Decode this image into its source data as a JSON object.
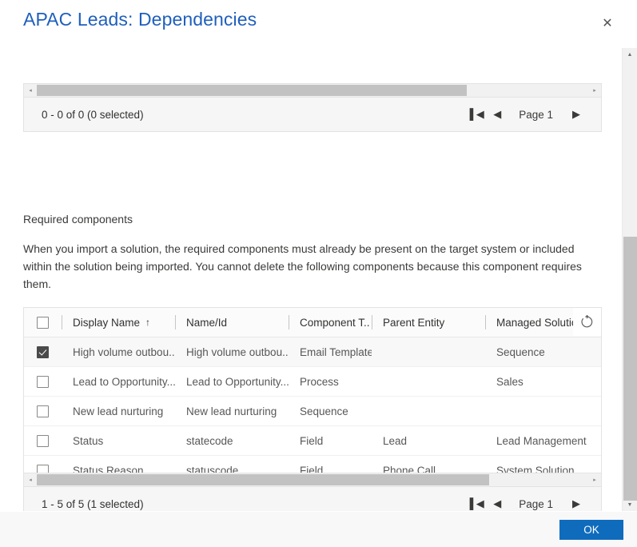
{
  "dialog": {
    "title": "APAC Leads: Dependencies",
    "close_label": "✕",
    "close_icon": "close-icon"
  },
  "top_grid": {
    "hscroll": {
      "left_arrow": "◂",
      "right_arrow": "▸",
      "thumb_percent": 78
    },
    "pager": {
      "count_text": "0 - 0 of 0 (0 selected)",
      "first_icon": "▌◀",
      "prev_icon": "◀",
      "page_label": "Page 1",
      "next_icon": "▶"
    }
  },
  "required": {
    "heading": "Required components",
    "description": "When you import a solution, the required components must already be present on the target system or included within the solution being imported. You cannot delete the following components because this component requires them."
  },
  "grid": {
    "select_all_checked": false,
    "spinner_icon": "refresh-spinner-icon",
    "columns": [
      {
        "key": "checkbox",
        "label": ""
      },
      {
        "key": "display_name",
        "label": "Display Name",
        "sort": "↑"
      },
      {
        "key": "name_id",
        "label": "Name/Id"
      },
      {
        "key": "component_type",
        "label": "Component T.."
      },
      {
        "key": "parent_entity",
        "label": "Parent Entity"
      },
      {
        "key": "managed_solution",
        "label": "Managed Solution"
      }
    ],
    "rows": [
      {
        "selected": true,
        "display_name": "High volume outbou...",
        "name_id": "High volume outbou...",
        "component_type": "Email Template",
        "parent_entity": "",
        "managed_solution": "Sequence"
      },
      {
        "selected": false,
        "display_name": "Lead to Opportunity...",
        "name_id": "Lead to Opportunity...",
        "component_type": "Process",
        "parent_entity": "",
        "managed_solution": "Sales"
      },
      {
        "selected": false,
        "display_name": "New lead nurturing",
        "name_id": "New lead nurturing",
        "component_type": "Sequence",
        "parent_entity": "",
        "managed_solution": ""
      },
      {
        "selected": false,
        "display_name": "Status",
        "name_id": "statecode",
        "component_type": "Field",
        "parent_entity": "Lead",
        "managed_solution": "Lead Management"
      },
      {
        "selected": false,
        "display_name": "Status Reason",
        "name_id": "statuscode",
        "component_type": "Field",
        "parent_entity": "Phone Call",
        "managed_solution": "System Solution"
      }
    ]
  },
  "bottom_grid": {
    "hscroll": {
      "left_arrow": "◂",
      "right_arrow": "▸",
      "thumb_percent": 82
    },
    "pager": {
      "count_text": "1 - 5 of 5 (1 selected)",
      "first_icon": "▌◀",
      "prev_icon": "◀",
      "page_label": "Page 1",
      "next_icon": "▶"
    }
  },
  "footer": {
    "ok_label": "OK"
  },
  "scrollbar": {
    "up_arrow": "▲",
    "down_arrow": "▼"
  },
  "colors": {
    "title": "#1f5fbd",
    "primary_button": "#0f6cbd",
    "scroll_thumb": "#c2c2c2"
  }
}
